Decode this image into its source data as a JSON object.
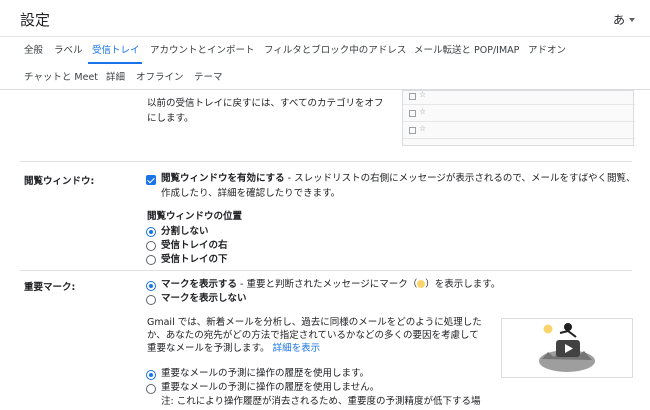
{
  "header": {
    "title": "設定",
    "lang_label": "あ"
  },
  "tabs": [
    {
      "label": "全般"
    },
    {
      "label": "ラベル"
    },
    {
      "label": "受信トレイ"
    },
    {
      "label": "アカウントとインポート"
    },
    {
      "label": "フィルタとブロック中のアドレス"
    },
    {
      "label": "メール転送と POP/IMAP"
    },
    {
      "label": "アドオン"
    },
    {
      "label": "チャットと Meet"
    },
    {
      "label": "詳細"
    },
    {
      "label": "オフライン"
    },
    {
      "label": "テーマ"
    }
  ],
  "inbox_note": {
    "line1": "以前の受信トレイに戻すには、すべてのカテゴリをオフ",
    "line2": "にします。"
  },
  "reading_pane": {
    "label": "閲覧ウィンドウ:",
    "enable_title": "閲覧ウィンドウを有効にする",
    "enable_desc1": " - スレッドリストの右側にメッセージが表示されるので、メールをすばやく閲覧、",
    "enable_desc2": "作成したり、詳細を確認したりできます。",
    "enabled": true,
    "position_title": "閲覧ウィンドウの位置",
    "positions": [
      "分割しない",
      "受信トレイの右",
      "受信トレイの下"
    ],
    "selected_position": "分割しない"
  },
  "importance": {
    "label": "重要マーク:",
    "show_title": "マークを表示する",
    "show_desc_a": " - 重要と判断されたメッセージにマーク（",
    "show_desc_b": "）を表示します。",
    "hide_title": "マークを表示しない",
    "gmail_line1": "Gmail では、新着メールを分析し、過去に同様のメールをどのように処理した",
    "gmail_line2": "か、あなたの宛先がどの方法で指定されているかなどの多くの要因を考慮して",
    "gmail_line3": "重要なメールを予測します。",
    "learn_more": "詳細を表示",
    "use_history": "重要なメールの予測に操作の履歴を使用します。",
    "no_history": "重要なメールの予測に操作の履歴を使用しません。",
    "note": "注: これにより操作履歴が消去されるため、重要度の予測精度が低下する場"
  },
  "colors": {
    "accent": "#1a73e8",
    "importance_marker": "#fbd46d"
  }
}
